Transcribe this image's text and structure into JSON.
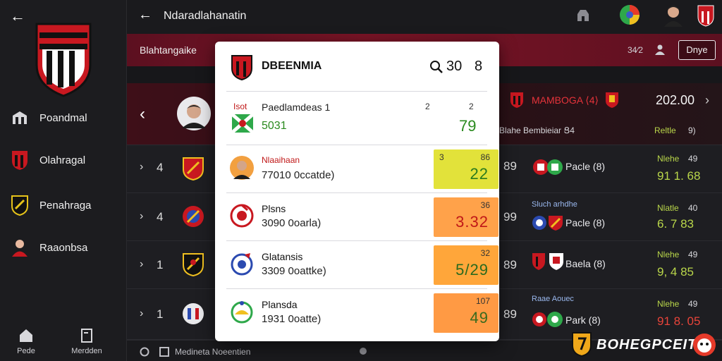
{
  "sidebar": {
    "back_glyph": "←",
    "items": [
      {
        "label": "Poandmal",
        "icon": "building-icon"
      },
      {
        "label": "Olahragal",
        "icon": "club-crest-icon"
      },
      {
        "label": "Penahraga",
        "icon": "shield-icon"
      },
      {
        "label": "Raaonbsa",
        "icon": "person-icon"
      }
    ],
    "bottom_nav": [
      {
        "label": "Pede",
        "icon": "home-icon"
      },
      {
        "label": "Merdden",
        "icon": "document-icon"
      }
    ]
  },
  "topbar": {
    "back_glyph": "←",
    "title": "Ndaradlahanatin"
  },
  "banner": {
    "label": "Blahtangaike",
    "count": "34⁄2",
    "button": "Dnye"
  },
  "rows": [
    {
      "chevron": "‹",
      "left_num": "",
      "right_num": "",
      "team": "MAMBOGA ⟨4⟩",
      "team_sub": "Blahe Bembieiar Ց4",
      "score": "202.00",
      "score_arrow": "›",
      "label": "Reltle",
      "label_num": "9)"
    },
    {
      "chevron": "›",
      "left_num": "4",
      "right_num": "89",
      "team": "",
      "team_sub": "Pacle (8)",
      "score": "91 1. 68",
      "label": "Nlehe",
      "label_num": "49"
    },
    {
      "chevron": "›",
      "left_num": "4",
      "right_num": "99",
      "team": "Sluch arhdhe",
      "team_sub": "Pacle (8)",
      "score": "6. 7 83",
      "label": "Nlatle",
      "label_num": "40"
    },
    {
      "chevron": "›",
      "left_num": "1",
      "right_num": "89",
      "team": "",
      "team_sub": "Baela (8)",
      "score": "9, 4 85",
      "label": "Nlehe",
      "label_num": "49"
    },
    {
      "chevron": "›",
      "left_num": "1",
      "right_num": "89",
      "team": "Raae Aouec",
      "team_sub": "Park (8)",
      "score": "91 8. 05",
      "label": "Nlehe",
      "label_num": "49"
    }
  ],
  "footer": {
    "text": "Medineta Noeentien"
  },
  "modal": {
    "title": "DBEENMIA",
    "title_stat": "30",
    "title_extra": "8",
    "header": {
      "prefix": "Isot",
      "label": "Paedlamdeas 1",
      "flag_text": "5031",
      "col1": "2",
      "col2": "2",
      "score": "79"
    },
    "items": [
      {
        "name": "Nlaaihaan",
        "sub": "77010 0ccatde)",
        "box_tl": "3",
        "box_tr": "86",
        "box_big": "22",
        "box_color": "#e2e23a",
        "big_color": "#2a7a1e"
      },
      {
        "name": "Plsns",
        "sub": "3090 0oarla)",
        "box_tl": "",
        "box_tr": "36",
        "box_big": "3.32",
        "box_color": "#ffa24a",
        "big_color": "#c01818"
      },
      {
        "name": "Glatansis",
        "sub": "3309 0oattke)",
        "box_tl": "",
        "box_tr": "32",
        "box_big": "5/29",
        "box_color": "#ffa63a",
        "big_color": "#2a6a1e"
      },
      {
        "name": "Plansda",
        "sub": "1931 0oatte)",
        "box_tl": "",
        "box_tr": "107",
        "box_big": "49",
        "box_color": "#ff9a44",
        "big_color": "#3a6a1e"
      }
    ]
  },
  "brand": {
    "text": "BOHEGPCEIT"
  }
}
